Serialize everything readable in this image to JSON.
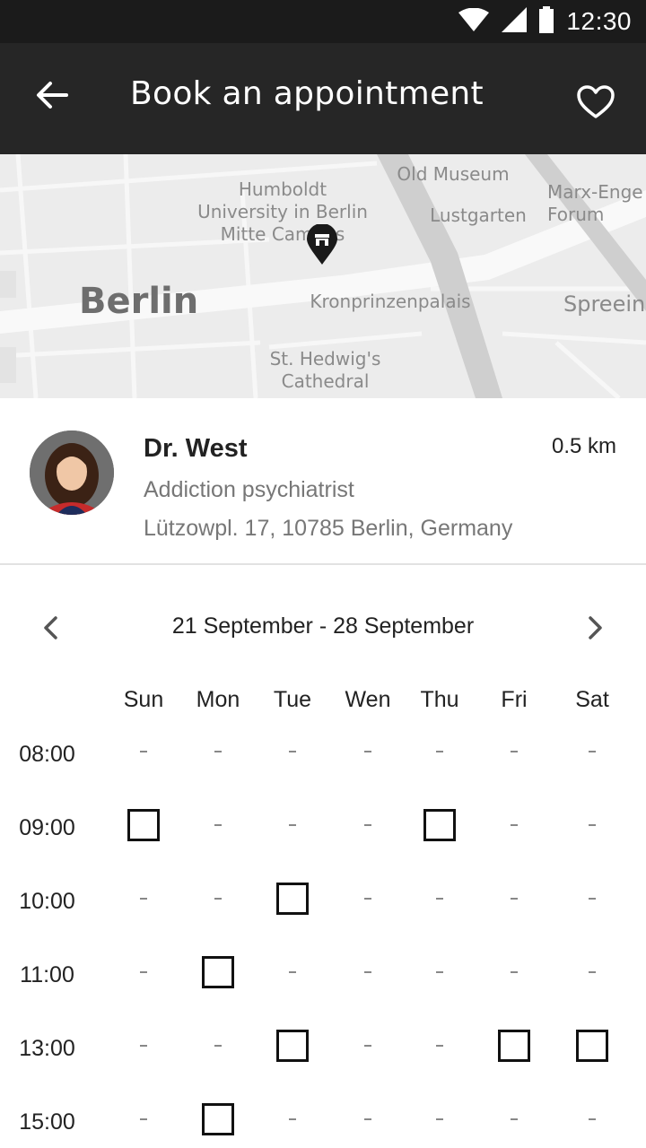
{
  "status_bar": {
    "time": "12:30",
    "icons": [
      "wifi-icon",
      "signal-icon",
      "battery-icon"
    ]
  },
  "app_bar": {
    "title": "Book an appointment",
    "back_icon": "arrow-left-icon",
    "favorite_icon": "heart-outline-icon"
  },
  "map": {
    "labels": {
      "humboldt": "Humboldt\nUniversity in Berlin\nMitte Campus",
      "old_museum": "Old Museum",
      "lustgarten": "Lustgarten",
      "marx": "Marx-Enge\nForum",
      "berlin": "Berlin",
      "kronprinzenpalais": "Kronprinzenpalais",
      "spree": "Spreein",
      "hedwig": "St. Hedwig's\nCathedral"
    },
    "pin_icon": "store-pin-icon"
  },
  "doctor": {
    "name": "Dr. West",
    "distance": "0.5 km",
    "specialty": "Addiction psychiatrist",
    "address": "Lützowpl. 17, 10785 Berlin, Germany"
  },
  "schedule": {
    "range": "21 September - 28 September",
    "prev_icon": "chevron-left-icon",
    "next_icon": "chevron-right-icon",
    "days": [
      "Sun",
      "Mon",
      "Tue",
      "Wen",
      "Thu",
      "Fri",
      "Sat"
    ],
    "times": [
      "08:00",
      "09:00",
      "10:00",
      "11:00",
      "13:00",
      "15:00"
    ],
    "unavailable_mark": "-",
    "slots": [
      [
        false,
        false,
        false,
        false,
        false,
        false,
        false
      ],
      [
        true,
        false,
        false,
        false,
        true,
        false,
        false
      ],
      [
        false,
        false,
        true,
        false,
        false,
        false,
        false
      ],
      [
        false,
        true,
        false,
        false,
        false,
        false,
        false
      ],
      [
        false,
        false,
        true,
        false,
        false,
        true,
        true
      ],
      [
        false,
        true,
        false,
        false,
        false,
        false,
        false
      ]
    ]
  },
  "colors": {
    "app_bar": "#262626",
    "status_bar": "#1b1b1b",
    "map_bg": "#ececec"
  }
}
